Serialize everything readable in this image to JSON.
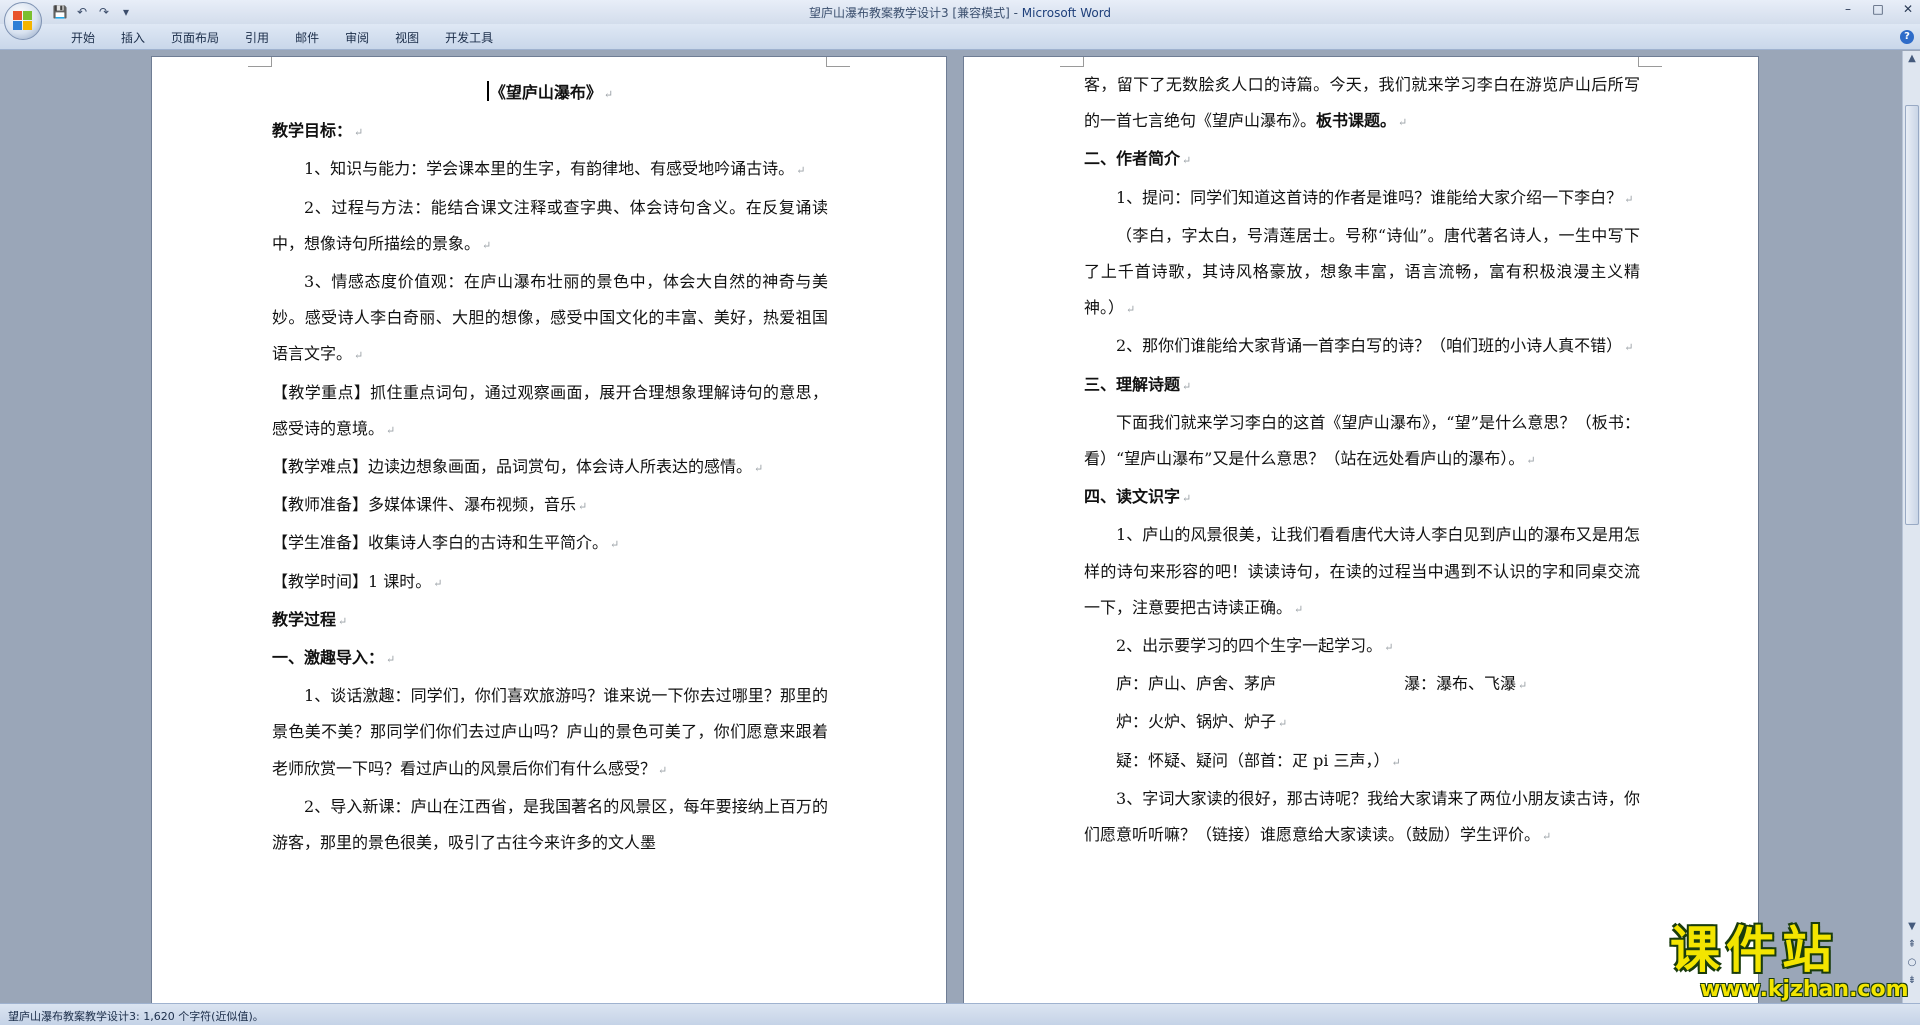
{
  "window": {
    "title_doc": "望庐山瀑布教案教学设计3 [兼容模式]",
    "title_app": "Microsoft Word",
    "minimize": "–",
    "maximize": "□",
    "close": "✕"
  },
  "qat": {
    "save": "💾",
    "undo": "↶",
    "redo": "↷",
    "more": "▾"
  },
  "tabs": [
    "开始",
    "插入",
    "页面布局",
    "引用",
    "邮件",
    "审阅",
    "视图",
    "开发工具"
  ],
  "page_left": {
    "title": "《望庐山瀑布》",
    "paragraphs": [
      "教学目标：",
      "1、知识与能力：学会课本里的生字，有韵律地、有感受地吟诵古诗。",
      "2、过程与方法：能结合课文注释或查字典、体会诗句含义。在反复诵读中，想像诗句所描绘的景象。",
      "3、情感态度价值观：在庐山瀑布壮丽的景色中，体会大自然的神奇与美妙。感受诗人李白奇丽、大胆的想像，感受中国文化的丰富、美好，热爱祖国语言文字。",
      "【教学重点】抓住重点词句，通过观察画面，展开合理想象理解诗句的意思，感受诗的意境。",
      "【教学难点】边读边想象画面，品词赏句，体会诗人所表达的感情。",
      "【教师准备】多媒体课件、瀑布视频，音乐",
      "【学生准备】收集诗人李白的古诗和生平简介。",
      "【教学时间】1 课时。",
      "教学过程",
      "一、激趣导入：",
      "1、谈话激趣：同学们，你们喜欢旅游吗？谁来说一下你去过哪里？那里的景色美不美？那同学们你们去过庐山吗？庐山的景色可美了，你们愿意来跟着老师欣赏一下吗？看过庐山的风景后你们有什么感受？",
      "2、导入新课：庐山在江西省，是我国著名的风景区，每年要接纳上百万的游客，那里的景色很美，吸引了古往今来许多的文人墨"
    ]
  },
  "page_right": {
    "paragraphs": [
      "客，留下了无数脍炙人口的诗篇。今天，我们就来学习李白在游览庐山后所写的一首七言绝句《望庐山瀑布》。",
      "板书课题。",
      "二、作者简介",
      "1、提问：同学们知道这首诗的作者是谁吗？谁能给大家介绍一下李白？",
      "（李白，字太白，号清莲居士。号称“诗仙”。唐代著名诗人，一生中写下了上千首诗歌，其诗风格豪放，想象丰富，语言流畅，富有积极浪漫主义精神。）",
      "2、那你们谁能给大家背诵一首李白写的诗？（咱们班的小诗人真不错）",
      "三、理解诗题",
      "下面我们就来学习李白的这首《望庐山瀑布》，“望”是什么意思？（板书：看）“望庐山瀑布”又是什么意思？（站在远处看庐山的瀑布）。",
      "四、读文识字",
      "1、庐山的风景很美，让我们看看唐代大诗人李白见到庐山的瀑布又是用怎样的诗句来形容的吧！读读诗句，在读的过程当中遇到不认识的字和同桌交流一下，注意要把古诗读正确。",
      "2、出示要学习的四个生字一起学习。",
      "庐：庐山、庐舍、茅庐",
      "瀑：瀑布、飞瀑",
      "炉：火炉、锅炉、炉子",
      "疑：怀疑、疑问（部首：疋 pi 三声，）",
      "3、字词大家读的很好，那古诗呢？我给大家请来了两位小朋友读古诗，你们愿意听听嘛？（链接）谁愿意给大家读读。（鼓励）学生评价。"
    ]
  },
  "marks": {
    "paragraph": "↵"
  },
  "status": {
    "text": "望庐山瀑布教案教学设计3: 1,620 个字符(近似值)。"
  },
  "watermark": {
    "big": "课件站",
    "url": "www.kjzhan.com"
  },
  "scrollbar": {
    "up": "▲",
    "down": "▼",
    "prev": "⇞",
    "next": "⇟",
    "select": "○"
  },
  "help": "?"
}
